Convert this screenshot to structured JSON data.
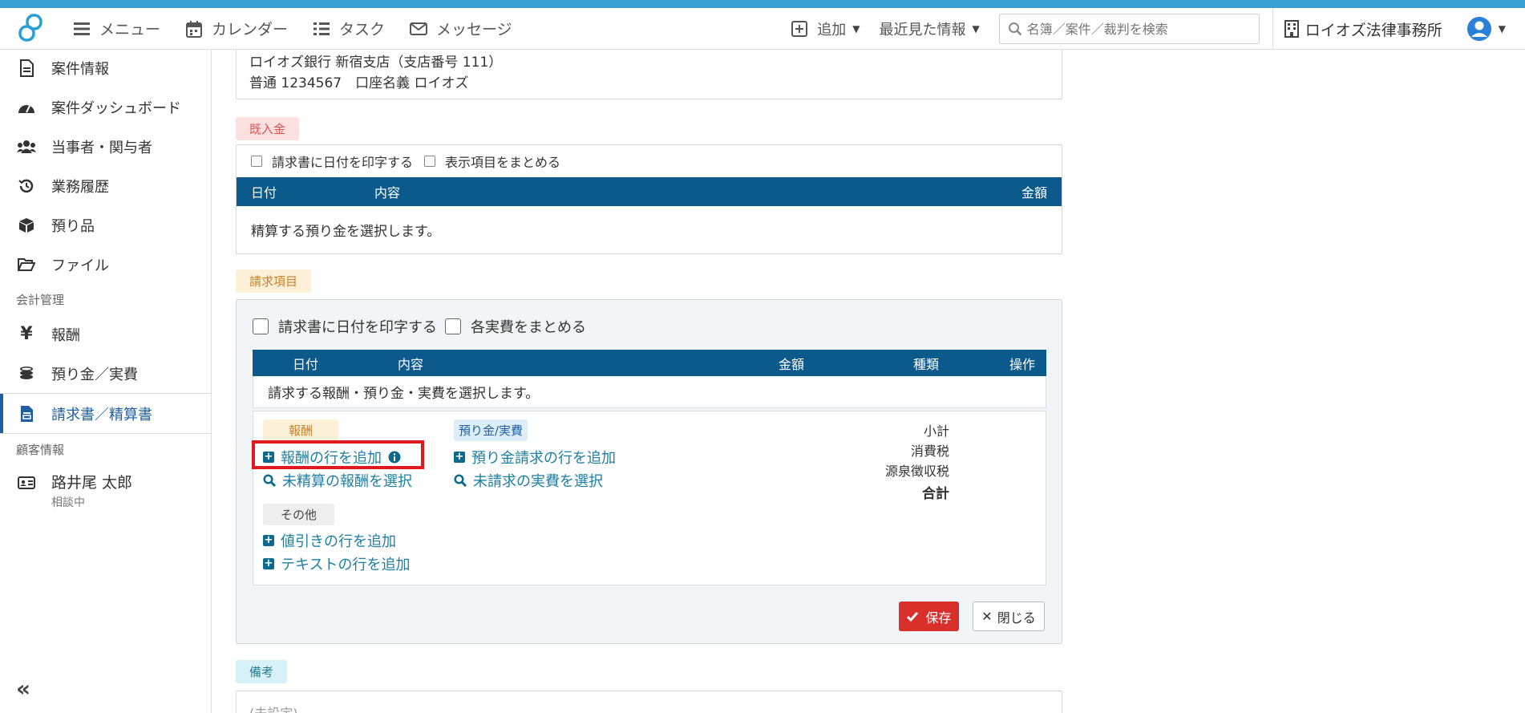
{
  "nav": {
    "menu": "メニュー",
    "calendar": "カレンダー",
    "tasks": "タスク",
    "messages": "メッセージ",
    "add": "追加",
    "recent": "最近見た情報",
    "search_placeholder": "名簿／案件／裁判を検索",
    "office": "ロイオズ法律事務所"
  },
  "sidebar": {
    "items": [
      {
        "label": "案件情報",
        "icon": "file-text-icon"
      },
      {
        "label": "案件ダッシュボード",
        "icon": "dashboard-gauge-icon"
      },
      {
        "label": "当事者・関与者",
        "icon": "users-icon"
      },
      {
        "label": "業務履歴",
        "icon": "history-icon"
      },
      {
        "label": "預り品",
        "icon": "box-icon"
      },
      {
        "label": "ファイル",
        "icon": "folder-open-icon"
      }
    ],
    "section_accounting": "会計管理",
    "accounting_items": [
      {
        "label": "報酬",
        "icon": "yen-icon"
      },
      {
        "label": "預り金／実費",
        "icon": "coins-icon"
      },
      {
        "label": "請求書／精算書",
        "icon": "invoice-icon",
        "active": true
      }
    ],
    "section_client": "顧客情報",
    "client": {
      "name": "路井尾 太郎",
      "status": "相談中"
    }
  },
  "bank": {
    "line1": "ロイオズ銀行 新宿支店（支店番号 111）",
    "line2": "普通 1234567　口座名義 ロイオズ"
  },
  "received": {
    "tag": "既入金",
    "check1": "請求書に日付を印字する",
    "check2": "表示項目をまとめる",
    "col_date": "日付",
    "col_content": "内容",
    "col_amount": "金額",
    "empty": "精算する預り金を選択します。"
  },
  "billing": {
    "tag": "請求項目",
    "check1": "請求書に日付を印字する",
    "check2": "各実費をまとめる",
    "col_date": "日付",
    "col_content": "内容",
    "col_amount": "金額",
    "col_type": "種類",
    "col_action": "操作",
    "empty": "請求する報酬・預り金・実費を選択します。",
    "fee_tag": "報酬",
    "add_fee_row": "報酬の行を追加",
    "select_fee": "未精算の報酬を選択",
    "deposit_tag": "預り金/実費",
    "add_deposit_row": "預り金請求の行を追加",
    "select_expense": "未請求の実費を選択",
    "other_tag": "その他",
    "add_discount_row": "値引きの行を追加",
    "add_text_row": "テキストの行を追加",
    "subtotal": "小計",
    "tax": "消費税",
    "withholding": "源泉徴収税",
    "total": "合計",
    "save": "保存",
    "close": "閉じる"
  },
  "remarks": {
    "tag": "備考",
    "value": "(未設定)"
  },
  "colors": {
    "topbar": "#3a9fd1",
    "table_header": "#0c5a8c",
    "save_button": "#d9302c",
    "highlight": "#e0191f",
    "link": "#1d7fa3"
  }
}
